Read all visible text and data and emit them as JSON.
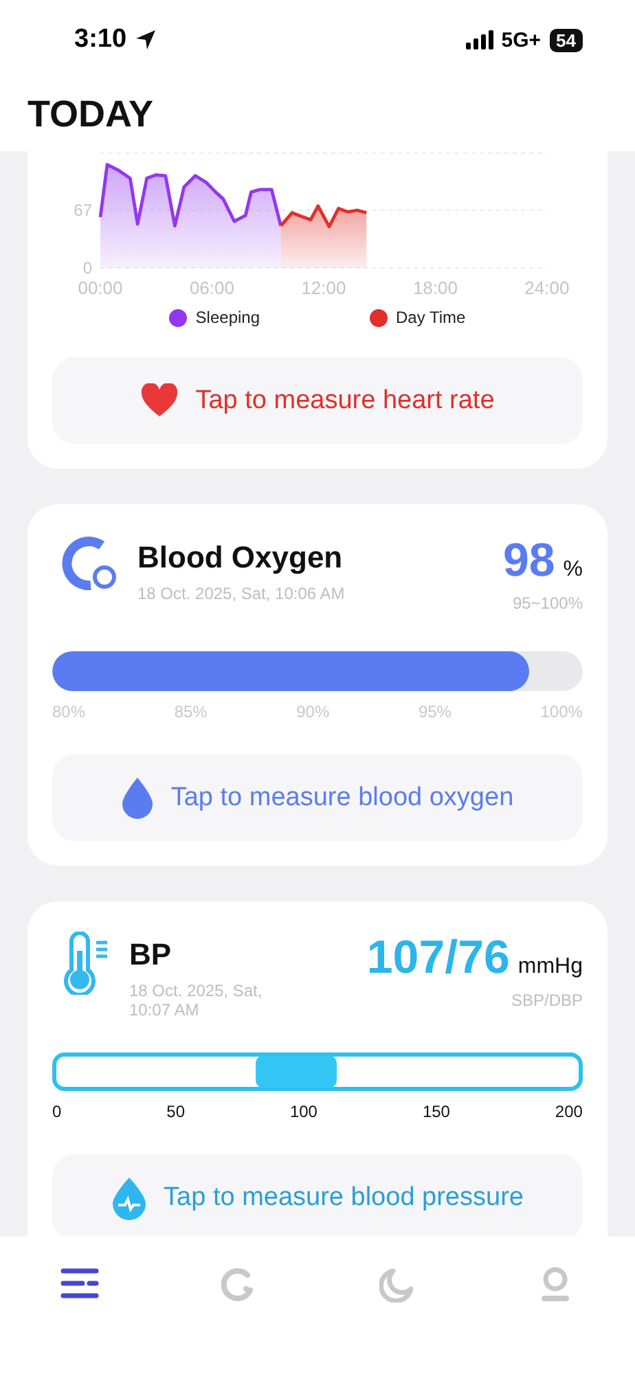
{
  "status_bar": {
    "time": "3:10",
    "network": "5G+",
    "battery": "54"
  },
  "header": {
    "title": "TODAY"
  },
  "heart_rate": {
    "chart_data": {
      "type": "area",
      "x": [
        0,
        0.37,
        1.0,
        1.6,
        2.0,
        2.5,
        3.0,
        3.5,
        4.0,
        4.5,
        5.1,
        5.7,
        6.2,
        6.6,
        7.2,
        7.8,
        8.1,
        8.6,
        9.2,
        9.7,
        10.3,
        10.9,
        11.3,
        11.7,
        12.3,
        12.8,
        13.3,
        13.8,
        14.3
      ],
      "xlim": [
        0,
        24
      ],
      "ylim": [
        0,
        135
      ],
      "yticks": [
        0,
        67
      ],
      "xticks": [
        {
          "value": 0,
          "label": "00:00"
        },
        {
          "value": 6,
          "label": "06:00"
        },
        {
          "value": 12,
          "label": "12:00"
        },
        {
          "value": 18,
          "label": "18:00"
        },
        {
          "value": 24,
          "label": "24:00"
        }
      ],
      "series": [
        {
          "name": "Sleeping",
          "color": "#9238ee",
          "values": [
            59,
            120,
            113,
            104,
            51,
            104,
            108,
            107,
            49,
            94,
            107,
            99,
            88,
            80,
            54,
            61,
            88,
            91,
            91,
            49,
            null,
            null,
            null,
            null,
            null,
            null,
            null,
            null,
            null
          ]
        },
        {
          "name": "Day Time",
          "color": "#e0302a",
          "values": [
            null,
            null,
            null,
            null,
            null,
            null,
            null,
            null,
            null,
            null,
            null,
            null,
            null,
            null,
            null,
            null,
            null,
            null,
            null,
            49,
            64,
            59,
            56,
            72,
            48,
            69,
            65,
            67,
            64
          ]
        }
      ]
    },
    "measure_button": "Tap to measure heart rate"
  },
  "blood_oxygen": {
    "title": "Blood Oxygen",
    "timestamp": "18 Oct. 2025, Sat, 10:06 AM",
    "value": "98",
    "unit": "%",
    "range": "95~100%",
    "level": 0.9,
    "scale": [
      "80%",
      "85%",
      "90%",
      "95%",
      "100%"
    ],
    "measure_button": "Tap to measure blood oxygen"
  },
  "bp": {
    "title": "BP",
    "timestamp": "18 Oct. 2025, Sat, 10:07 AM",
    "value": "107/76",
    "unit": "mmHg",
    "range": "SBP/DBP",
    "level": 0.46,
    "scale": [
      "0",
      "50",
      "100",
      "150",
      "200"
    ],
    "measure_button": "Tap to measure blood pressure"
  },
  "tab_bar": [
    {
      "kind": "list",
      "selected": true
    },
    {
      "kind": "activity",
      "selected": false
    },
    {
      "kind": "sleep",
      "selected": false
    },
    {
      "kind": "profile",
      "selected": false
    }
  ]
}
